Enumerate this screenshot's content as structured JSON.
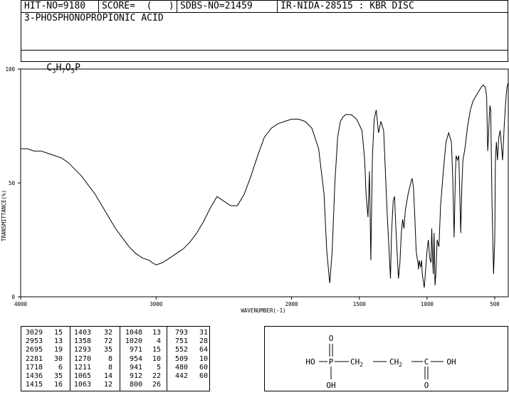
{
  "header": {
    "hit_no": "HIT-NO=9180",
    "score": "SCORE=  (   )",
    "sdbs_no": "SDBS-NO=21459",
    "ir_info": "IR-NIDA-28515 : KBR DISC",
    "compound_name": "3-PHOSPHONOPROPIONIC ACID",
    "formula_parts": [
      "C",
      "3",
      "H",
      "7",
      "O",
      "5",
      "P"
    ]
  },
  "chart_data": {
    "type": "line",
    "xlabel": "WAVENUMBER(-1)",
    "ylabel": "TRANSMITTANCE(%)",
    "xlim": [
      4000,
      400
    ],
    "ylim": [
      0,
      100
    ],
    "x_ticks": [
      4000,
      3000,
      2000,
      1500,
      1000,
      500
    ],
    "y_ticks": [
      0,
      50,
      100
    ],
    "series": [
      {
        "points": [
          [
            4000,
            65
          ],
          [
            3950,
            65
          ],
          [
            3900,
            64
          ],
          [
            3850,
            64
          ],
          [
            3800,
            63
          ],
          [
            3750,
            62
          ],
          [
            3700,
            61
          ],
          [
            3650,
            59
          ],
          [
            3600,
            56
          ],
          [
            3550,
            53
          ],
          [
            3500,
            49
          ],
          [
            3450,
            45
          ],
          [
            3400,
            40
          ],
          [
            3350,
            35
          ],
          [
            3300,
            30
          ],
          [
            3250,
            26
          ],
          [
            3200,
            22
          ],
          [
            3150,
            19
          ],
          [
            3100,
            17
          ],
          [
            3050,
            16
          ],
          [
            3029,
            15
          ],
          [
            3000,
            14
          ],
          [
            2953,
            15
          ],
          [
            2900,
            17
          ],
          [
            2850,
            19
          ],
          [
            2800,
            21
          ],
          [
            2750,
            24
          ],
          [
            2700,
            28
          ],
          [
            2650,
            33
          ],
          [
            2600,
            39
          ],
          [
            2550,
            44
          ],
          [
            2500,
            42
          ],
          [
            2450,
            40
          ],
          [
            2400,
            40
          ],
          [
            2350,
            45
          ],
          [
            2300,
            53
          ],
          [
            2250,
            62
          ],
          [
            2201,
            70
          ],
          [
            2150,
            74
          ],
          [
            2100,
            76
          ],
          [
            2050,
            77
          ],
          [
            2000,
            78
          ],
          [
            1950,
            78
          ],
          [
            1900,
            77
          ],
          [
            1850,
            74
          ],
          [
            1800,
            65
          ],
          [
            1760,
            45
          ],
          [
            1740,
            20
          ],
          [
            1718,
            6
          ],
          [
            1700,
            20
          ],
          [
            1680,
            50
          ],
          [
            1660,
            70
          ],
          [
            1640,
            77
          ],
          [
            1620,
            79
          ],
          [
            1600,
            80
          ],
          [
            1560,
            80
          ],
          [
            1520,
            78
          ],
          [
            1480,
            73
          ],
          [
            1460,
            60
          ],
          [
            1450,
            45
          ],
          [
            1436,
            35
          ],
          [
            1425,
            55
          ],
          [
            1415,
            16
          ],
          [
            1405,
            55
          ],
          [
            1403,
            62
          ],
          [
            1390,
            78
          ],
          [
            1375,
            82
          ],
          [
            1358,
            72
          ],
          [
            1340,
            77
          ],
          [
            1320,
            73
          ],
          [
            1293,
            35
          ],
          [
            1280,
            20
          ],
          [
            1270,
            8
          ],
          [
            1262,
            28
          ],
          [
            1250,
            42
          ],
          [
            1240,
            44
          ],
          [
            1230,
            30
          ],
          [
            1211,
            8
          ],
          [
            1200,
            15
          ],
          [
            1190,
            28
          ],
          [
            1180,
            34
          ],
          [
            1170,
            30
          ],
          [
            1160,
            38
          ],
          [
            1140,
            45
          ],
          [
            1120,
            50
          ],
          [
            1110,
            52
          ],
          [
            1100,
            48
          ],
          [
            1090,
            35
          ],
          [
            1080,
            20
          ],
          [
            1065,
            14
          ],
          [
            1063,
            12
          ],
          [
            1058,
            16
          ],
          [
            1048,
            13
          ],
          [
            1040,
            16
          ],
          [
            1035,
            10
          ],
          [
            1028,
            7
          ],
          [
            1020,
            4
          ],
          [
            1010,
            12
          ],
          [
            1000,
            20
          ],
          [
            990,
            25
          ],
          [
            980,
            17
          ],
          [
            971,
            15
          ],
          [
            965,
            30
          ],
          [
            960,
            20
          ],
          [
            954,
            10
          ],
          [
            948,
            28
          ],
          [
            941,
            5
          ],
          [
            935,
            10
          ],
          [
            925,
            25
          ],
          [
            912,
            22
          ],
          [
            900,
            40
          ],
          [
            880,
            55
          ],
          [
            860,
            68
          ],
          [
            840,
            72
          ],
          [
            820,
            68
          ],
          [
            810,
            52
          ],
          [
            800,
            26
          ],
          [
            795,
            40
          ],
          [
            790,
            55
          ],
          [
            785,
            62
          ],
          [
            775,
            60
          ],
          [
            765,
            62
          ],
          [
            760,
            50
          ],
          [
            751,
            28
          ],
          [
            742,
            50
          ],
          [
            735,
            60
          ],
          [
            720,
            65
          ],
          [
            700,
            75
          ],
          [
            680,
            82
          ],
          [
            660,
            86
          ],
          [
            640,
            88
          ],
          [
            620,
            90
          ],
          [
            600,
            92
          ],
          [
            585,
            93
          ],
          [
            570,
            92
          ],
          [
            560,
            88
          ],
          [
            552,
            64
          ],
          [
            545,
            72
          ],
          [
            540,
            80
          ],
          [
            535,
            84
          ],
          [
            530,
            82
          ],
          [
            520,
            40
          ],
          [
            509,
            10
          ],
          [
            500,
            25
          ],
          [
            495,
            60
          ],
          [
            488,
            68
          ],
          [
            480,
            60
          ],
          [
            470,
            70
          ],
          [
            460,
            73
          ],
          [
            450,
            66
          ],
          [
            442,
            60
          ],
          [
            430,
            75
          ],
          [
            420,
            85
          ],
          [
            410,
            92
          ],
          [
            400,
            94
          ]
        ]
      }
    ],
    "peak_table": [
      [
        [
          3029,
          15
        ],
        [
          2953,
          13
        ],
        [
          2695,
          19
        ],
        [
          2281,
          30
        ],
        [
          1718,
          6
        ],
        [
          1436,
          35
        ],
        [
          1415,
          16
        ]
      ],
      [
        [
          1403,
          32
        ],
        [
          1358,
          72
        ],
        [
          1293,
          35
        ],
        [
          1270,
          8
        ],
        [
          1211,
          8
        ],
        [
          1065,
          14
        ],
        [
          1063,
          12
        ]
      ],
      [
        [
          1048,
          13
        ],
        [
          1020,
          4
        ],
        [
          971,
          15
        ],
        [
          954,
          10
        ],
        [
          941,
          5
        ],
        [
          912,
          22
        ],
        [
          800,
          26
        ]
      ],
      [
        [
          793,
          31
        ],
        [
          751,
          28
        ],
        [
          552,
          64
        ],
        [
          509,
          10
        ],
        [
          480,
          60
        ],
        [
          442,
          60
        ]
      ]
    ]
  },
  "structure": {
    "o_top": "O",
    "ho_left": "HO",
    "p": "P",
    "ch2_first": "CH",
    "ch2_first_sub": "2",
    "ch2_second": "CH",
    "ch2_second_sub": "2",
    "c": "C",
    "oh_right": "OH",
    "oh_bottom": "OH",
    "o_bottom": "O"
  }
}
